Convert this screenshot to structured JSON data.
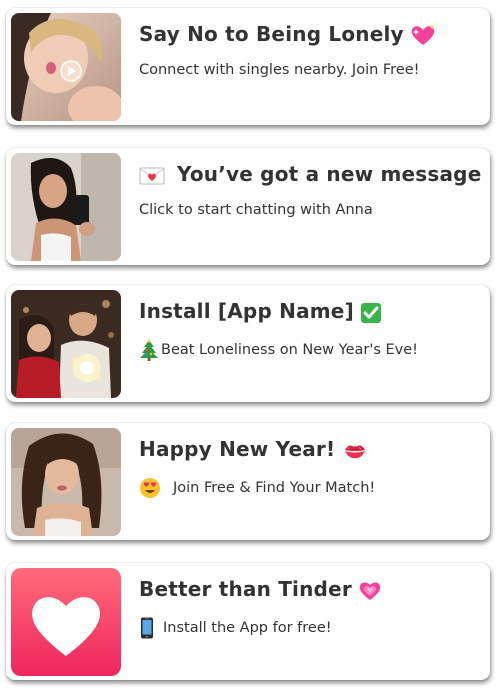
{
  "notifications": [
    {
      "title": "Say No to Being Lonely",
      "title_emoji": "sparkling-heart",
      "subtitle": "Connect with singles nearby. Join Free!",
      "thumbnail": "woman-selfie-photo-with-play-button"
    },
    {
      "title": "You’ve got a new message",
      "title_emoji": "love-letter",
      "subtitle": "Click to start chatting with Anna",
      "thumbnail": "woman-mirror-selfie-photo"
    },
    {
      "title": "Install [App Name]",
      "title_emoji": "check-mark-button",
      "subtitle": "Beat Loneliness on New Year's Eve!",
      "subtitle_emoji": "christmas-tree",
      "thumbnail": "couple-with-sparklers-photo"
    },
    {
      "title": "Happy New Year!",
      "title_emoji": "kiss-mark",
      "subtitle": "Join Free & Find Your Match!",
      "subtitle_emoji": "heart-eyes-face",
      "thumbnail": "woman-portrait-photo"
    },
    {
      "title": "Better than Tinder",
      "title_emoji": "growing-heart",
      "subtitle": "Install the App for free!",
      "subtitle_emoji": "mobile-phone",
      "thumbnail": "white-heart-app-icon"
    }
  ],
  "colors": {
    "text": "#333333",
    "app_icon_gradient_top": "#ff6b7a",
    "app_icon_gradient_bottom": "#f0255e",
    "check_green": "#3bb44a",
    "heart_pink": "#f5409a"
  }
}
